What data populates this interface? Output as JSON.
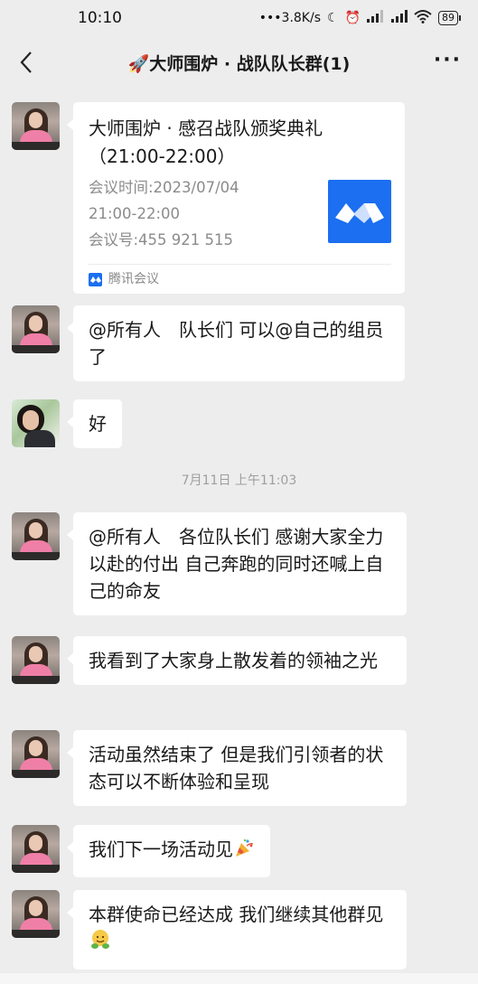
{
  "status_bar": {
    "time": "10:10",
    "net_speed": "•••3.8K/s",
    "battery": "89"
  },
  "header": {
    "title": "🚀大师围炉 · 战队队长群(1)"
  },
  "messages": [
    {
      "type": "meeting_card",
      "title": "大师围炉 · 感召战队颁奖典礼（21:00-22:00）",
      "time_line1": "会议时间:2023/07/04",
      "time_line2": "21:00-22:00",
      "meeting_id": "会议号:455 921 515",
      "source": "腾讯会议"
    },
    {
      "type": "text",
      "text": "@所有人　队长们 可以@自己的组员了"
    },
    {
      "type": "text",
      "text": "好"
    },
    {
      "type": "timestamp",
      "text": "7月11日 上午11:03"
    },
    {
      "type": "text",
      "text": "@所有人　各位队长们 感谢大家全力以赴的付出 自己奔跑的同时还喊上自己的命友"
    },
    {
      "type": "text",
      "text": "我看到了大家身上散发着的领袖之光"
    },
    {
      "type": "text",
      "text": "活动虽然结束了 但是我们引领者的状态可以不断体验和呈现"
    },
    {
      "type": "text",
      "text": "我们下一场活动见"
    },
    {
      "type": "text",
      "text": "本群使命已经达成 我们继续其他群见"
    }
  ]
}
